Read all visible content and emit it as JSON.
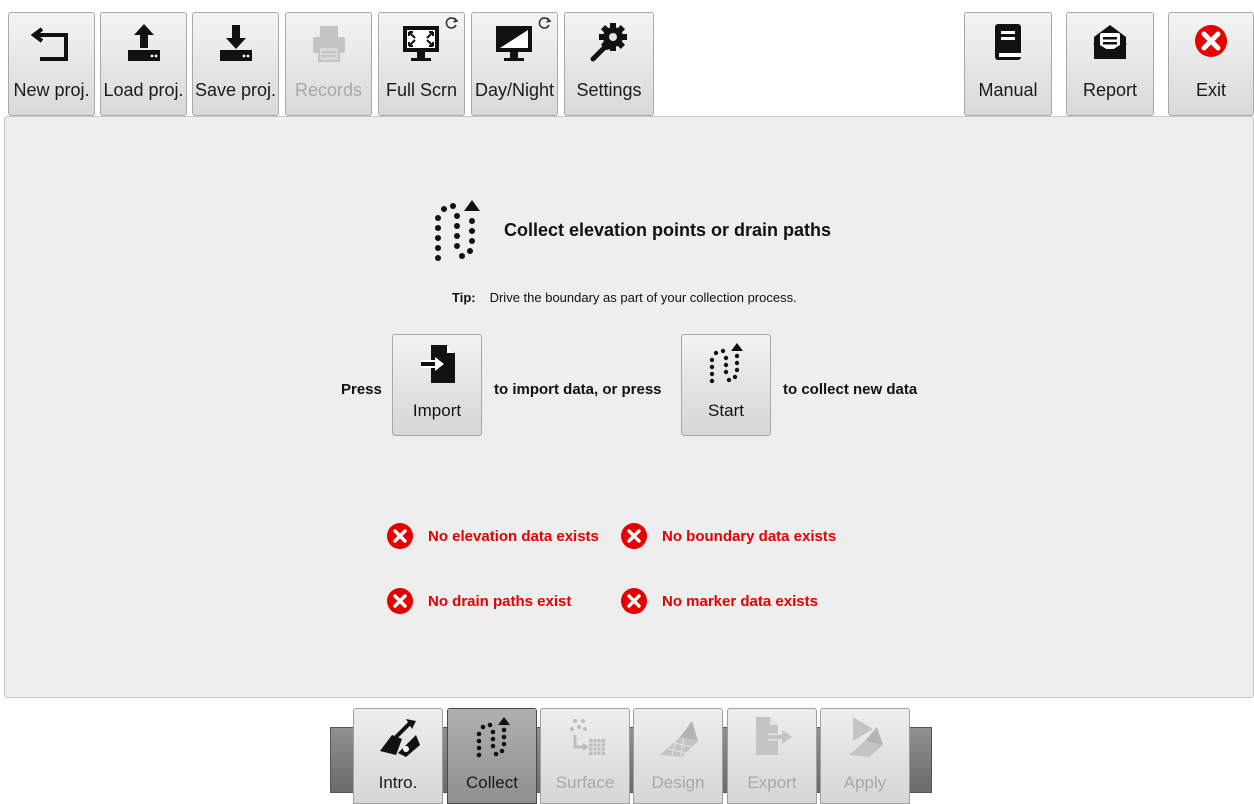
{
  "toolbar": {
    "new_project": {
      "label": "New proj.",
      "icon": "undo-arrow-icon"
    },
    "load_project": {
      "label": "Load proj.",
      "icon": "upload-icon"
    },
    "save_project": {
      "label": "Save proj.",
      "icon": "download-icon"
    },
    "records": {
      "label": "Records",
      "icon": "printer-icon",
      "enabled": false
    },
    "full_screen": {
      "label": "Full Scrn",
      "icon": "fullscreen-monitor-icon"
    },
    "day_night": {
      "label": "Day/Night",
      "icon": "day-night-monitor-icon"
    },
    "settings": {
      "label": "Settings",
      "icon": "gear-wrench-icon"
    },
    "manual": {
      "label": "Manual",
      "icon": "book-icon"
    },
    "report": {
      "label": "Report",
      "icon": "envelope-report-icon"
    },
    "exit": {
      "label": "Exit",
      "icon": "close-circle-icon",
      "color": "#e60000"
    }
  },
  "main": {
    "heading": "Collect elevation points or drain paths",
    "tip_label": "Tip:",
    "tip_text": "Drive the boundary as part of your collection process.",
    "press_text": "Press",
    "import_button": "Import",
    "middle_text": "to import data, or press",
    "start_button": "Start",
    "end_text": "to collect new data",
    "status": [
      "No elevation data exists",
      "No boundary data exists",
      "No drain paths exist",
      "No marker data exists"
    ],
    "status_color": "#e60000"
  },
  "tabs": [
    {
      "label": "Intro.",
      "icon": "tractor-blade-icon",
      "enabled": true,
      "active": false
    },
    {
      "label": "Collect",
      "icon": "dotted-path-icon",
      "enabled": true,
      "active": true
    },
    {
      "label": "Surface",
      "icon": "surface-grid-icon",
      "enabled": false,
      "active": false
    },
    {
      "label": "Design",
      "icon": "design-plane-icon",
      "enabled": false,
      "active": false
    },
    {
      "label": "Export",
      "icon": "export-file-icon",
      "enabled": false,
      "active": false
    },
    {
      "label": "Apply",
      "icon": "apply-play-icon",
      "enabled": false,
      "active": false
    }
  ]
}
